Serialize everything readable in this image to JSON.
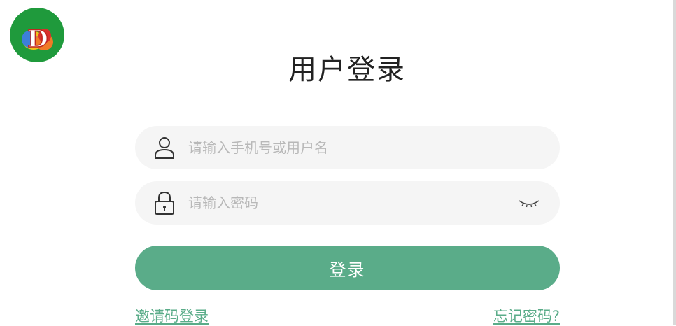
{
  "logo": {
    "letter": "D",
    "icon": "brand-logo-icon",
    "colors": {
      "ring": "#1f9a3c",
      "blob_blue": "#3d7fd9",
      "blob_yellow": "#f2c21b",
      "blob_orange": "#f07a26",
      "blob_red": "#d9302b"
    }
  },
  "title": "用户登录",
  "username": {
    "placeholder": "请输入手机号或用户名",
    "value": "",
    "icon": "user-icon"
  },
  "password": {
    "placeholder": "请输入密码",
    "value": "",
    "icon": "lock-icon",
    "toggle_icon": "eye-closed-icon"
  },
  "login_button": {
    "label": "登录"
  },
  "links": {
    "invite_login": "邀请码登录",
    "forgot_password": "忘记密码?"
  },
  "colors": {
    "accent": "#5aac89",
    "field_bg": "#f5f5f5",
    "placeholder": "#b8b8b8",
    "title": "#222222"
  }
}
